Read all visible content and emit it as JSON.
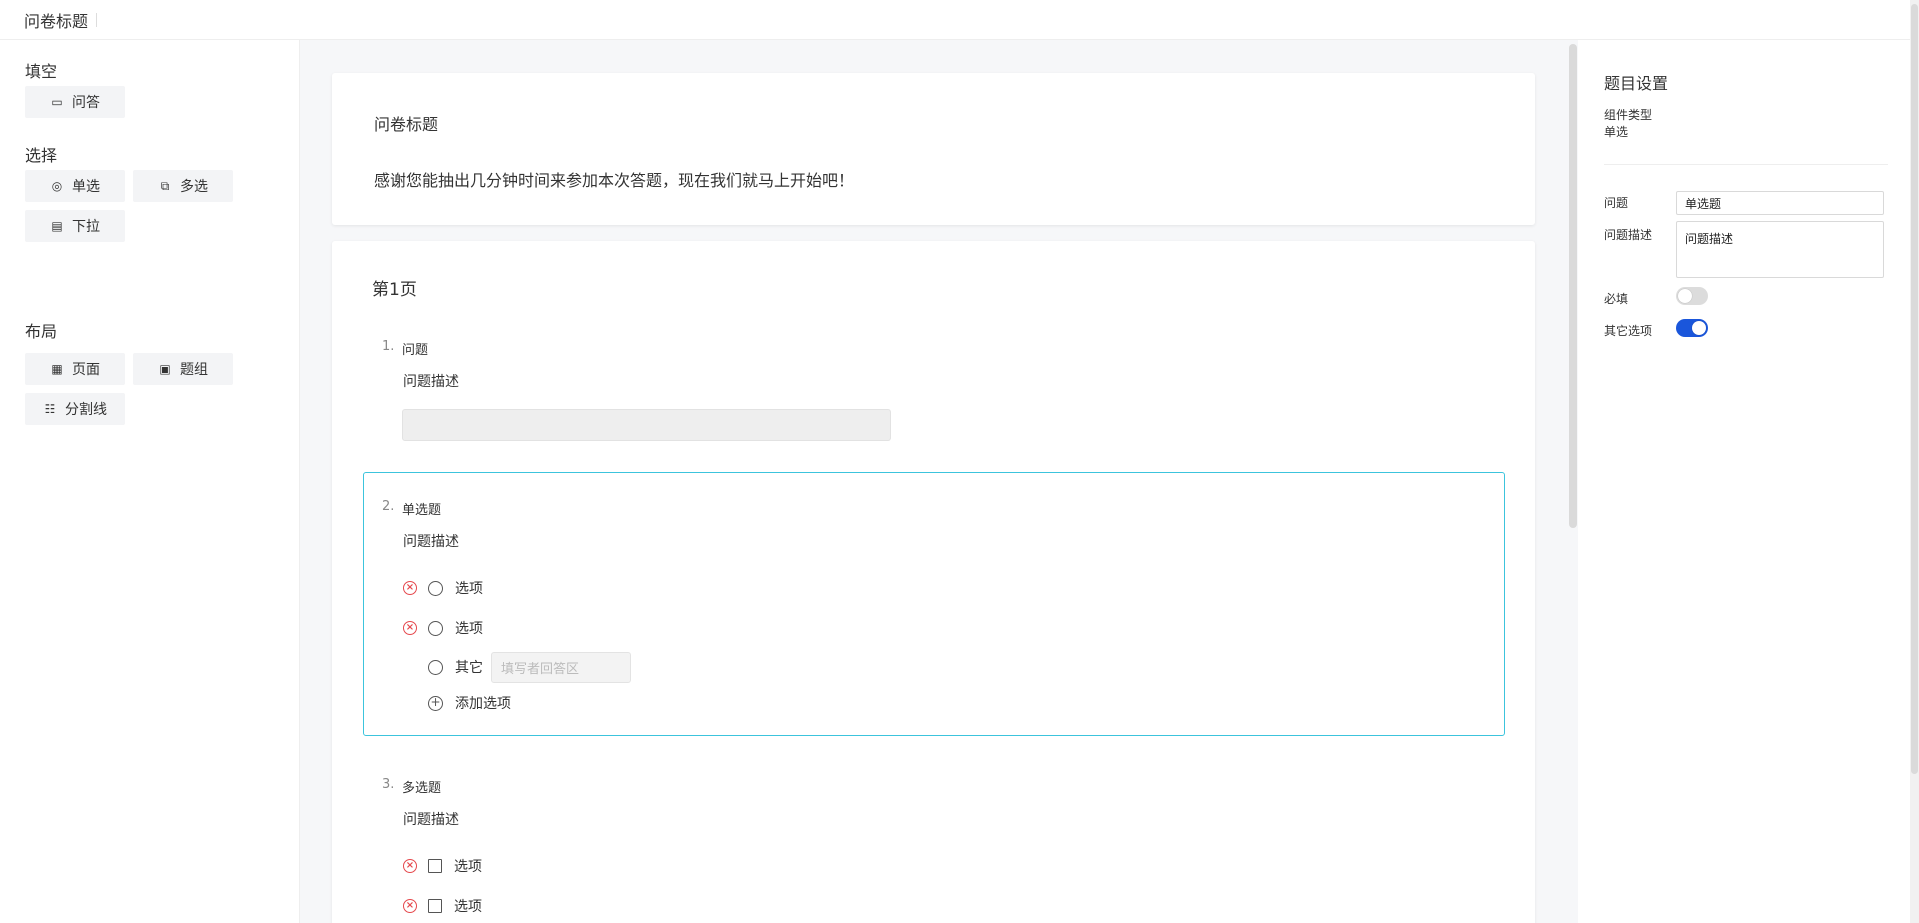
{
  "app": {
    "title": "问卷标题"
  },
  "components": {
    "groups": [
      {
        "title": "填空",
        "items": [
          {
            "label": "问答",
            "icon": "textbox-icon"
          }
        ]
      },
      {
        "title": "选择",
        "items": [
          {
            "label": "单选",
            "icon": "radio-icon"
          },
          {
            "label": "多选",
            "icon": "copy-icon"
          },
          {
            "label": "下拉",
            "icon": "dropdown-icon"
          }
        ]
      },
      {
        "title": "布局",
        "items": [
          {
            "label": "页面",
            "icon": "page-icon"
          },
          {
            "label": "题组",
            "icon": "group-icon"
          },
          {
            "label": "分割线",
            "icon": "divider-icon"
          }
        ]
      }
    ]
  },
  "survey": {
    "title": "问卷标题",
    "description": "感谢您能抽出几分钟时间来参加本次答题，现在我们就马上开始吧！",
    "page_title": "第1页",
    "questions": [
      {
        "num": "1.",
        "title": "问题",
        "description": "问题描述"
      },
      {
        "num": "2.",
        "title": "单选题",
        "description": "问题描述",
        "options": [
          "选项",
          "选项"
        ],
        "other_label": "其它",
        "other_placeholder": "填写者回答区",
        "add_label": "添加选项"
      },
      {
        "num": "3.",
        "title": "多选题",
        "description": "问题描述",
        "options": [
          "选项",
          "选项"
        ]
      }
    ]
  },
  "settings": {
    "title": "题目设置",
    "component_type_label": "组件类型",
    "component_type_value": "单选",
    "question_label": "问题",
    "question_value": "单选题",
    "desc_label": "问题描述",
    "desc_value": "问题描述",
    "required_label": "必填",
    "required_on": false,
    "other_label": "其它选项",
    "other_on": true,
    "toggle_on_color": "#1a56db"
  }
}
